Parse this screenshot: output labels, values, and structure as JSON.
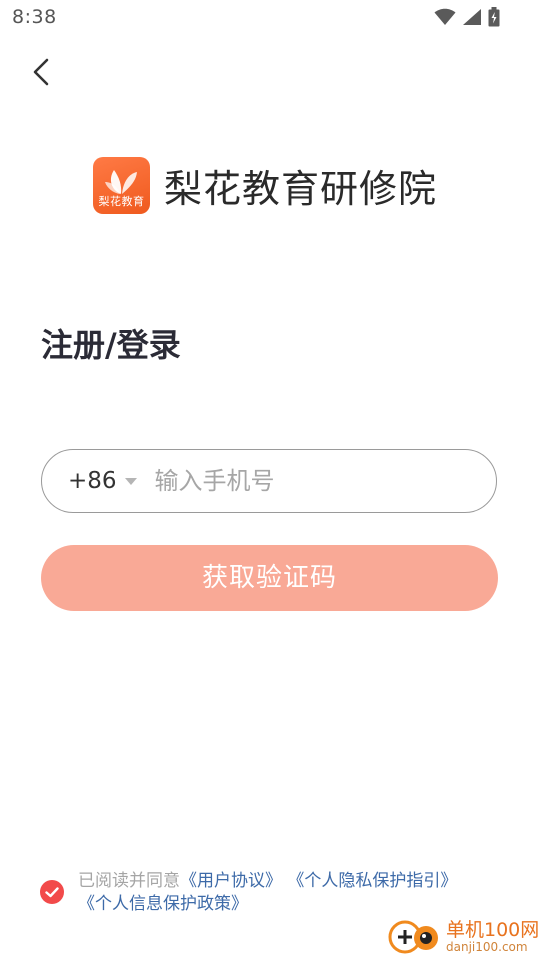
{
  "status_bar": {
    "time": "8:38",
    "icons": [
      "wifi-icon",
      "signal-icon",
      "battery-icon"
    ]
  },
  "header": {
    "back_icon": "chevron-left-icon",
    "app_logo_text": "梨花教育",
    "app_name": "梨花教育研修院"
  },
  "page_title": "注册/登录",
  "phone_form": {
    "country_code": "+86",
    "phone_placeholder": "输入手机号",
    "phone_value": ""
  },
  "get_code_button": {
    "label": "获取验证码"
  },
  "agreement": {
    "checked": true,
    "prefix": "已阅读并同意",
    "user_agreement": "《用户协议》",
    "privacy_guide": "《个人隐私保护指引》",
    "info_policy": "《个人信息保护政策》"
  },
  "watermark": {
    "title": "单机100网",
    "url": "danji100.com"
  },
  "colors": {
    "accent": "#f9a996",
    "checkbox": "#f24a4a",
    "link": "#3d6aa8",
    "logo": "#ef5a1e"
  }
}
